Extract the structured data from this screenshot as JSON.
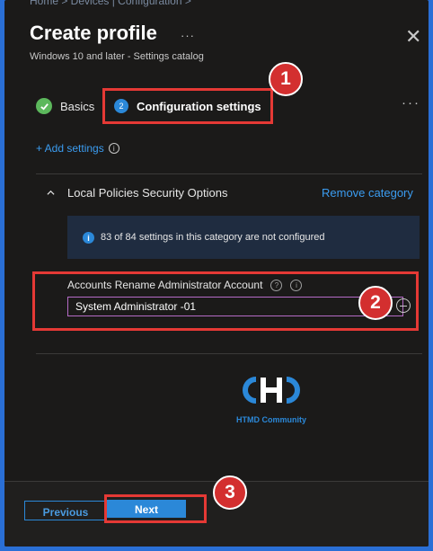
{
  "header": {
    "breadcrumb": "Home > Devices | Configuration >",
    "title": "Create profile",
    "title_menu": "···",
    "subtitle": "Windows 10 and later - Settings catalog"
  },
  "wizard": {
    "steps": [
      {
        "label": "Basics",
        "state": "complete"
      },
      {
        "label": "Configuration settings",
        "state": "current",
        "number": "2"
      }
    ],
    "more": "···"
  },
  "add_settings": {
    "label": "+ Add settings"
  },
  "category": {
    "title": "Local Policies Security Options",
    "remove_label": "Remove category",
    "info_text": "83 of 84 settings in this category are not configured",
    "setting": {
      "label": "Accounts Rename Administrator Account",
      "value": "System Administrator -01"
    }
  },
  "watermark": {
    "text": "HTMD Community"
  },
  "footer": {
    "previous_label": "Previous",
    "next_label": "Next"
  },
  "annotations": [
    "1",
    "2",
    "3"
  ],
  "colors": {
    "accent": "#2b88d8",
    "annotation_red": "#e53935",
    "background": "#1b1a19"
  }
}
